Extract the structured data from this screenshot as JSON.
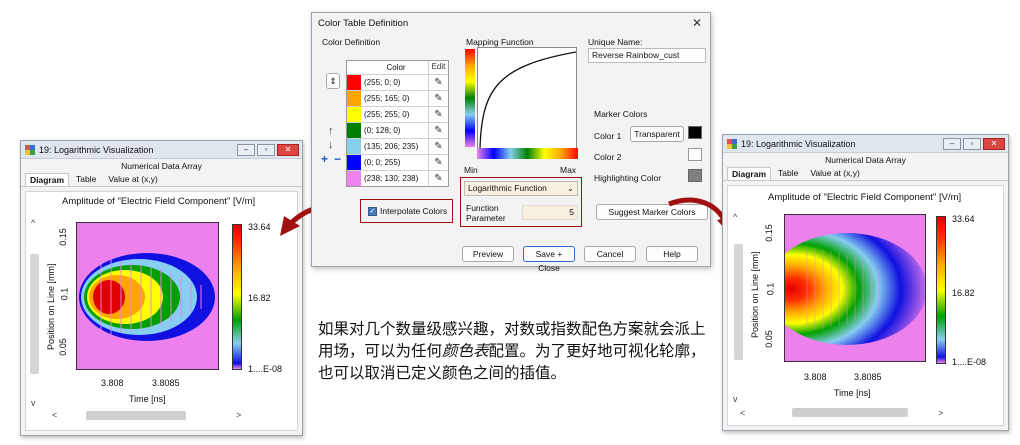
{
  "left_window": {
    "title": "19: Logarithmic Visualization",
    "subtitle": "Numerical Data Array",
    "tabs": [
      "Diagram",
      "Table",
      "Value at (x,y)"
    ],
    "plot_title": "Amplitude of \"Electric Field Component\"  [V/m]",
    "ylabel": "Position on Line [mm]",
    "xlabel": "Time [ns]",
    "yticks": [
      "0.15",
      "0.1",
      "0.05"
    ],
    "xticks": [
      "3.808",
      "3.8085"
    ],
    "cbar_ticks": [
      "33.64",
      "16.82",
      "1....E-08"
    ]
  },
  "right_window": {
    "title": "19: Logarithmic Visualization",
    "subtitle": "Numerical Data Array",
    "tabs": [
      "Diagram",
      "Table",
      "Value at (x,y)"
    ],
    "plot_title": "Amplitude of \"Electric Field Component\"  [V/m]",
    "ylabel": "Position on Line [mm]",
    "xlabel": "Time [ns]",
    "yticks": [
      "0.15",
      "0.1",
      "0.05"
    ],
    "xticks": [
      "3.808",
      "3.8085"
    ],
    "cbar_ticks": [
      "33.64",
      "16.82",
      "1....E-08"
    ]
  },
  "dialog": {
    "title": "Color Table Definition",
    "color_definition_label": "Color Definition",
    "col_color": "Color",
    "col_edit": "Edit",
    "colors": [
      {
        "text": "(255; 0; 0)",
        "hex": "#ff0000"
      },
      {
        "text": "(255; 165; 0)",
        "hex": "#ffa500"
      },
      {
        "text": "(255; 255; 0)",
        "hex": "#ffff00"
      },
      {
        "text": "(0; 128; 0)",
        "hex": "#008000"
      },
      {
        "text": "(135; 206; 235)",
        "hex": "#87ceeb"
      },
      {
        "text": "(0; 0; 255)",
        "hex": "#0000ff"
      },
      {
        "text": "(238; 130; 238)",
        "hex": "#ee82ee"
      }
    ],
    "mapping_function_label": "Mapping Function",
    "min_label": "Min",
    "max_label": "Max",
    "unique_name_label": "Unique Name:",
    "unique_name_value": "Reverse Rainbow_cust",
    "marker_colors_label": "Marker Colors",
    "color1_label": "Color 1",
    "transparent_label": "Transparent",
    "color2_label": "Color 2",
    "highlight_label": "Highlighting Color",
    "interpolate_label": "Interpolate Colors",
    "function_select": "Logarithmic Function",
    "function_param_label": "Function Parameter",
    "function_param_value": "5",
    "suggest_label": "Suggest Marker Colors",
    "preview_label": "Preview",
    "save_close_label": "Save + Close",
    "cancel_label": "Cancel",
    "help_label": "Help"
  },
  "caption": {
    "part1": "如果对几个数量级感兴趣，对数或指数配色方案就会派上用场，可以为任何",
    "italic": "颜色表",
    "part2": "配置。为了更好地可视化轮廓，也可以取消已定义颜色之间的插值。"
  },
  "colors": {
    "accent_red": "#a01010",
    "plot_bg": "#ec80ec"
  }
}
